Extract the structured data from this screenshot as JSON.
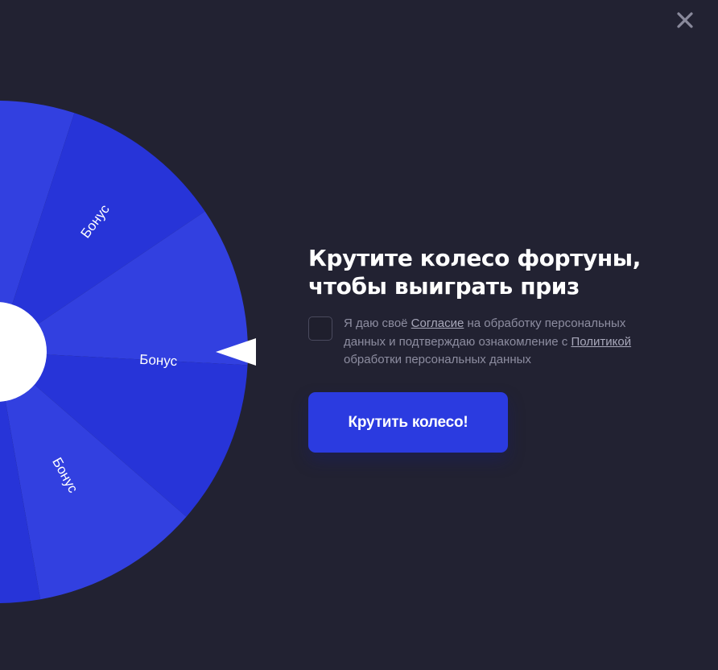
{
  "popup": {
    "close_icon": "close-icon"
  },
  "wheel": {
    "segment_label": "Бонус",
    "colors": {
      "segment_dark": "#2734d8",
      "segment_light": "#3240e0",
      "center": "#ffffff",
      "pointer": "#ffffff"
    },
    "segments": [
      {
        "label": "Бонус"
      },
      {
        "label": "Бонус"
      },
      {
        "label": "Бонус"
      },
      {
        "label": "Бонус"
      }
    ]
  },
  "heading": {
    "line1": "Крутите колесо фортуны,",
    "line2": "чтобы выиграть приз"
  },
  "consent": {
    "text_before": "Я даю своё ",
    "agreement_link": "Согласие",
    "text_middle_1": " на обработку персональных",
    "text_middle_2": "данных и подтверждаю ознакомление с ",
    "policy_link": "Политикой",
    "text_end": "обработки персональных данных"
  },
  "spin_button": {
    "label": "Крутить колесо!"
  },
  "theme": {
    "background": "#222232",
    "accent": "#2b3be0",
    "muted_text": "#8d8da0"
  }
}
